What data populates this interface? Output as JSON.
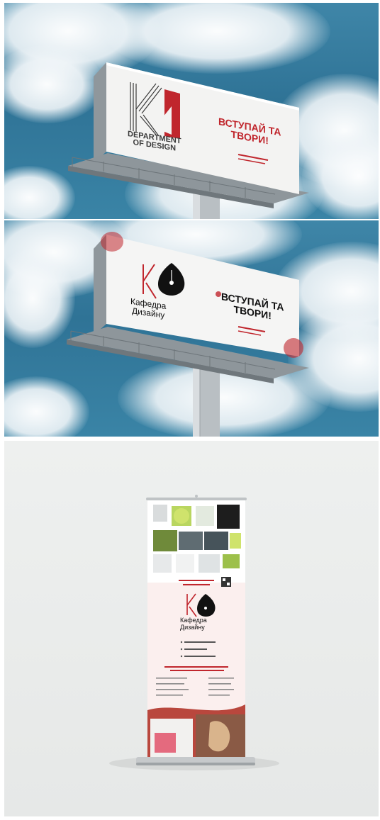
{
  "billboard_1": {
    "dept_line1": "DEPARTMENT",
    "dept_line2": "OF DESIGN",
    "slogan_line1": "ВСТУПАЙ ТА",
    "slogan_line2": "ТВОРИ!",
    "accent": "#c0262d",
    "logo_color": "#3a3a3a"
  },
  "billboard_2": {
    "dept_line1": "Кафедра",
    "dept_line2": "Дизайну",
    "slogan_line1": "ВСТУПАЙ ТА",
    "slogan_line2": "ТВОРИ!",
    "accent": "#c0262d",
    "text_color": "#111111"
  },
  "rollup": {
    "dept_line1": "Кафедра",
    "dept_line2": "Дизайну",
    "accent": "#c0262d"
  },
  "colors": {
    "sky": "#2f7396",
    "studio": "#eceeed"
  }
}
